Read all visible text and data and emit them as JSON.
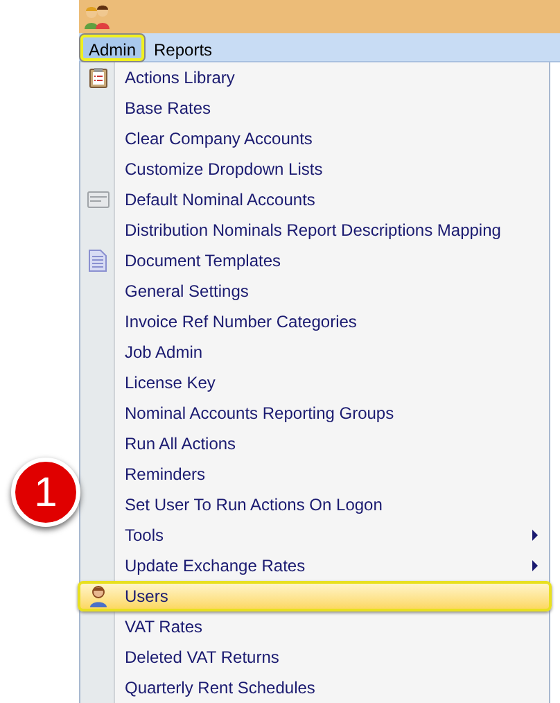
{
  "menu_bar": [
    {
      "label": "Admin",
      "selected": true
    },
    {
      "label": "Reports",
      "selected": false
    }
  ],
  "menu": [
    {
      "label": "Actions Library",
      "selected": false,
      "submenu": false,
      "kind": "clipboard"
    },
    {
      "label": "Base Rates",
      "selected": false,
      "submenu": false
    },
    {
      "label": "Clear Company Accounts",
      "selected": false,
      "submenu": false
    },
    {
      "label": "Customize Dropdown Lists",
      "selected": false,
      "submenu": false
    },
    {
      "label": "Default Nominal Accounts",
      "selected": false,
      "submenu": false,
      "kind": "card"
    },
    {
      "label": "Distribution Nominals Report Descriptions Mapping",
      "selected": false,
      "submenu": false
    },
    {
      "label": "Document Templates",
      "selected": false,
      "submenu": false,
      "kind": "document"
    },
    {
      "label": "General Settings",
      "selected": false,
      "submenu": false
    },
    {
      "label": "Invoice Ref Number Categories",
      "selected": false,
      "submenu": false
    },
    {
      "label": "Job Admin",
      "selected": false,
      "submenu": false
    },
    {
      "label": "License Key",
      "selected": false,
      "submenu": false
    },
    {
      "label": "Nominal Accounts Reporting Groups",
      "selected": false,
      "submenu": false
    },
    {
      "label": "Run All Actions",
      "selected": false,
      "submenu": false
    },
    {
      "label": "Reminders",
      "selected": false,
      "submenu": false
    },
    {
      "label": "Set User To Run Actions On Logon",
      "selected": false,
      "submenu": false
    },
    {
      "label": "Tools",
      "selected": false,
      "submenu": true
    },
    {
      "label": "Update Exchange Rates",
      "selected": false,
      "submenu": true
    },
    {
      "label": "Users",
      "selected": true,
      "submenu": false,
      "kind": "person"
    },
    {
      "label": "VAT Rates",
      "selected": false,
      "submenu": false
    },
    {
      "label": "Deleted VAT Returns",
      "selected": false,
      "submenu": false
    },
    {
      "label": "Quarterly Rent Schedules",
      "selected": false,
      "submenu": false
    }
  ],
  "callout": {
    "label": "1"
  }
}
